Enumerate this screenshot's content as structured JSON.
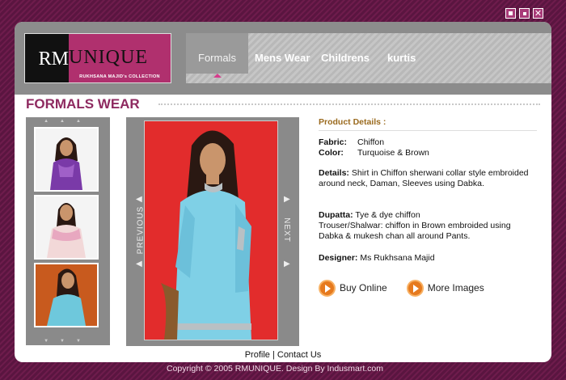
{
  "window": {
    "min_icon": "minimize-icon",
    "max_icon": "maximize-icon",
    "close_icon": "close-icon",
    "close_glyph": "✕"
  },
  "logo": {
    "rm": "RM",
    "unique": "UNIQUE",
    "tagline": "RUKHSANA MAJID's COLLECTION"
  },
  "nav": {
    "items": [
      "Formals",
      "Mens Wear",
      "Childrens",
      "kurtis"
    ],
    "active": "Formals"
  },
  "page": {
    "title": "FORMALS WEAR"
  },
  "viewer": {
    "prev": "PREVIOUS",
    "next": "NEXT"
  },
  "details": {
    "title": "Product Details :",
    "fabric_label": "Fabric:",
    "fabric": "Chiffon",
    "color_label": "Color:",
    "color": "Turquoise & Brown",
    "details_label": "Details:",
    "details_text": "Shirt in Chiffon sherwani collar style embroided around neck, Daman, Sleeves using Dabka.",
    "dupatta_label": "Dupatta:",
    "dupatta": "Tye & dye chiffon",
    "trouser_text": "Trouser/Shalwar: chiffon in Brown embroided using Dabka & mukesh chan all around Pants.",
    "designer_label": "Designer:",
    "designer": "Ms Rukhsana Majid"
  },
  "buttons": {
    "buy": "Buy Online",
    "more": "More Images"
  },
  "footer": {
    "profile": "Profile",
    "sep": "|",
    "contact": "Contact Us",
    "copyright": "Copyright © 2005 RMUNIQUE. Design By Indusmart.com"
  },
  "colors": {
    "brand": "#8e2a60",
    "accent_orange": "#e67a1e",
    "bg": "#6e1c4c"
  }
}
